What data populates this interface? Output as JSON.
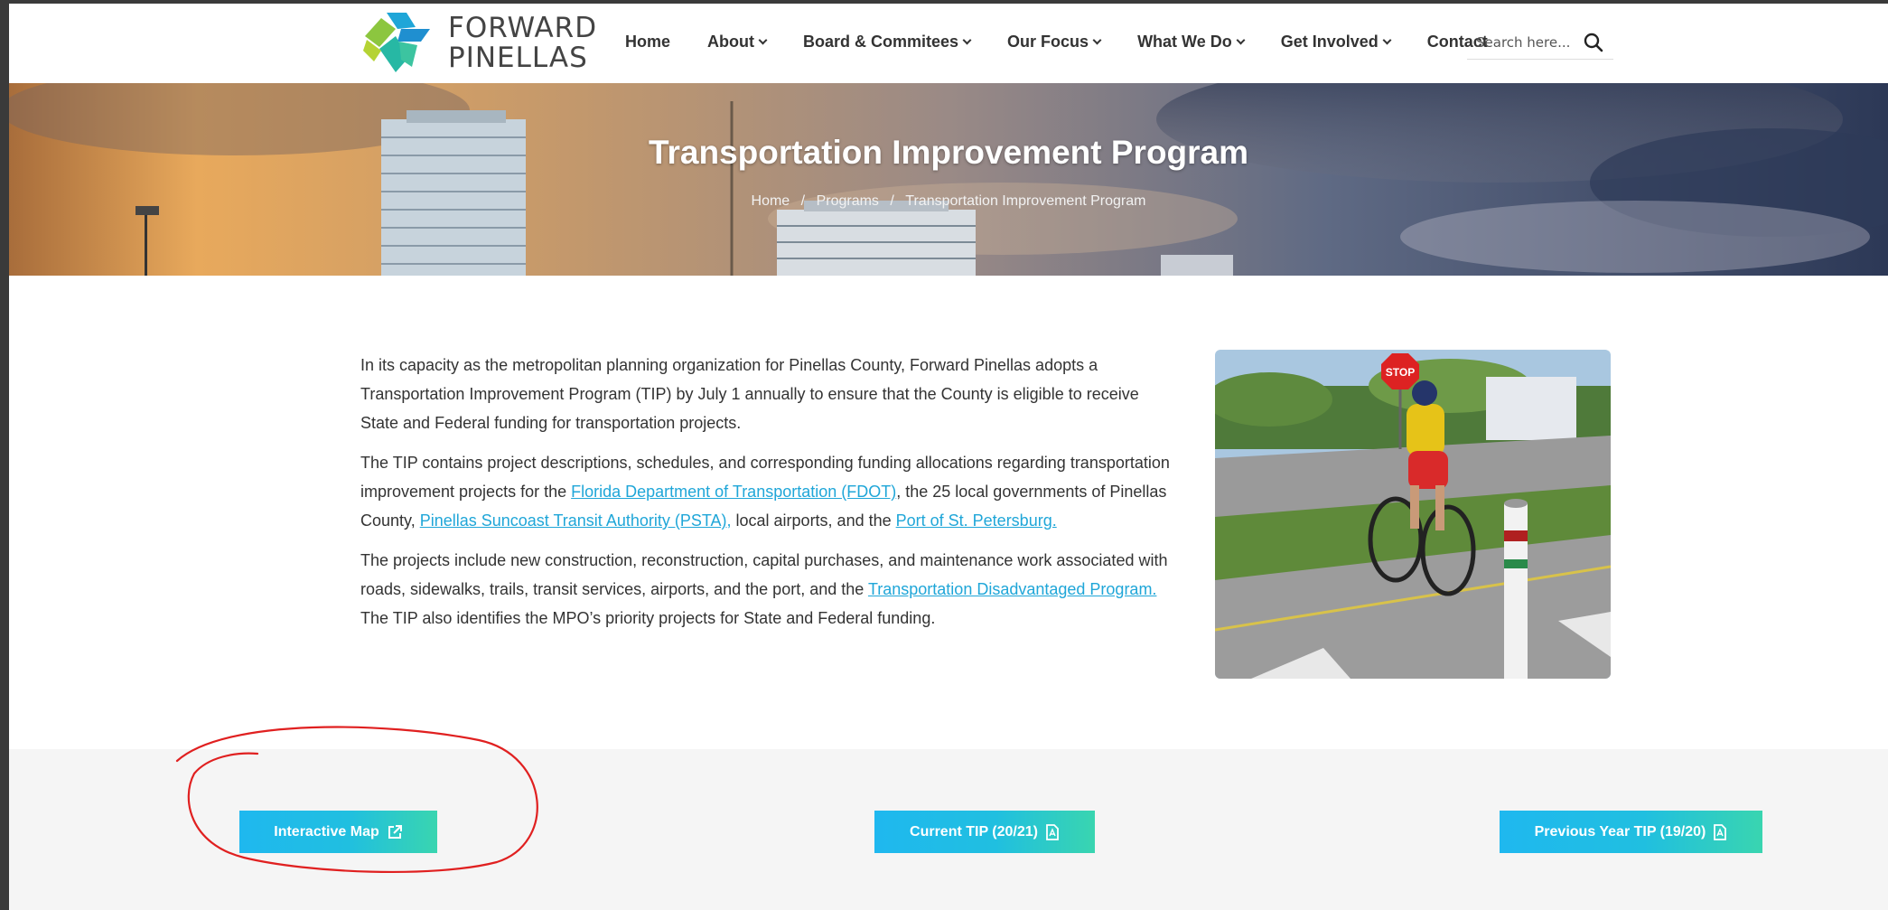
{
  "brand": {
    "logo_line1": "FORWARD",
    "logo_line2": "PINELLAS"
  },
  "nav": {
    "items": [
      {
        "label": "Home"
      },
      {
        "label": "About"
      },
      {
        "label": "Board & Commitees"
      },
      {
        "label": "Our Focus"
      },
      {
        "label": "What We Do"
      },
      {
        "label": "Get Involved"
      },
      {
        "label": "Contact"
      }
    ]
  },
  "search": {
    "placeholder": "Search here..."
  },
  "hero": {
    "title": "Transportation Improvement Program",
    "breadcrumb": [
      "Home",
      "Programs",
      "Transportation Improvement Program"
    ],
    "separator": "/"
  },
  "content": {
    "p1": "In its capacity as the metropolitan planning organization for Pinellas County, Forward Pinellas adopts a Transportation Improvement Program (TIP) by July 1 annually to ensure that the County is eligible to receive State and Federal funding for transportation projects.",
    "p2_a": "The TIP contains project descriptions, schedules, and corresponding funding allocations regarding transportation improvement projects for the ",
    "p2_link1": "Florida Department of Transportation (FDOT)",
    "p2_b": ", the 25 local governments of Pinellas County, ",
    "p2_link2": "Pinellas Suncoast Transit Authority (PSTA),",
    "p2_c": " local airports, and the ",
    "p2_link3": "Port of St. Petersburg.",
    "p3_a": "The projects include new construction, reconstruction, capital purchases, and maintenance work associated with roads, sidewalks, trails, transit services, airports, and the port, and the ",
    "p3_link": "Transportation Disadvantaged Program.",
    "p3_b": " The TIP also identifies the MPO’s priority projects for State and Federal funding."
  },
  "photo": {
    "sign_text": "STOP"
  },
  "buttons": [
    {
      "label": "Interactive Map",
      "icon": "external-link-icon"
    },
    {
      "label": "Current TIP (20/21)",
      "icon": "pdf-icon"
    },
    {
      "label": "Previous Year TIP (19/20)",
      "icon": "pdf-icon"
    }
  ],
  "colors": {
    "accent": "#1fb8ef",
    "accent_end": "#39d5b0",
    "link": "#1fa6d8",
    "annotation": "#e02020"
  }
}
